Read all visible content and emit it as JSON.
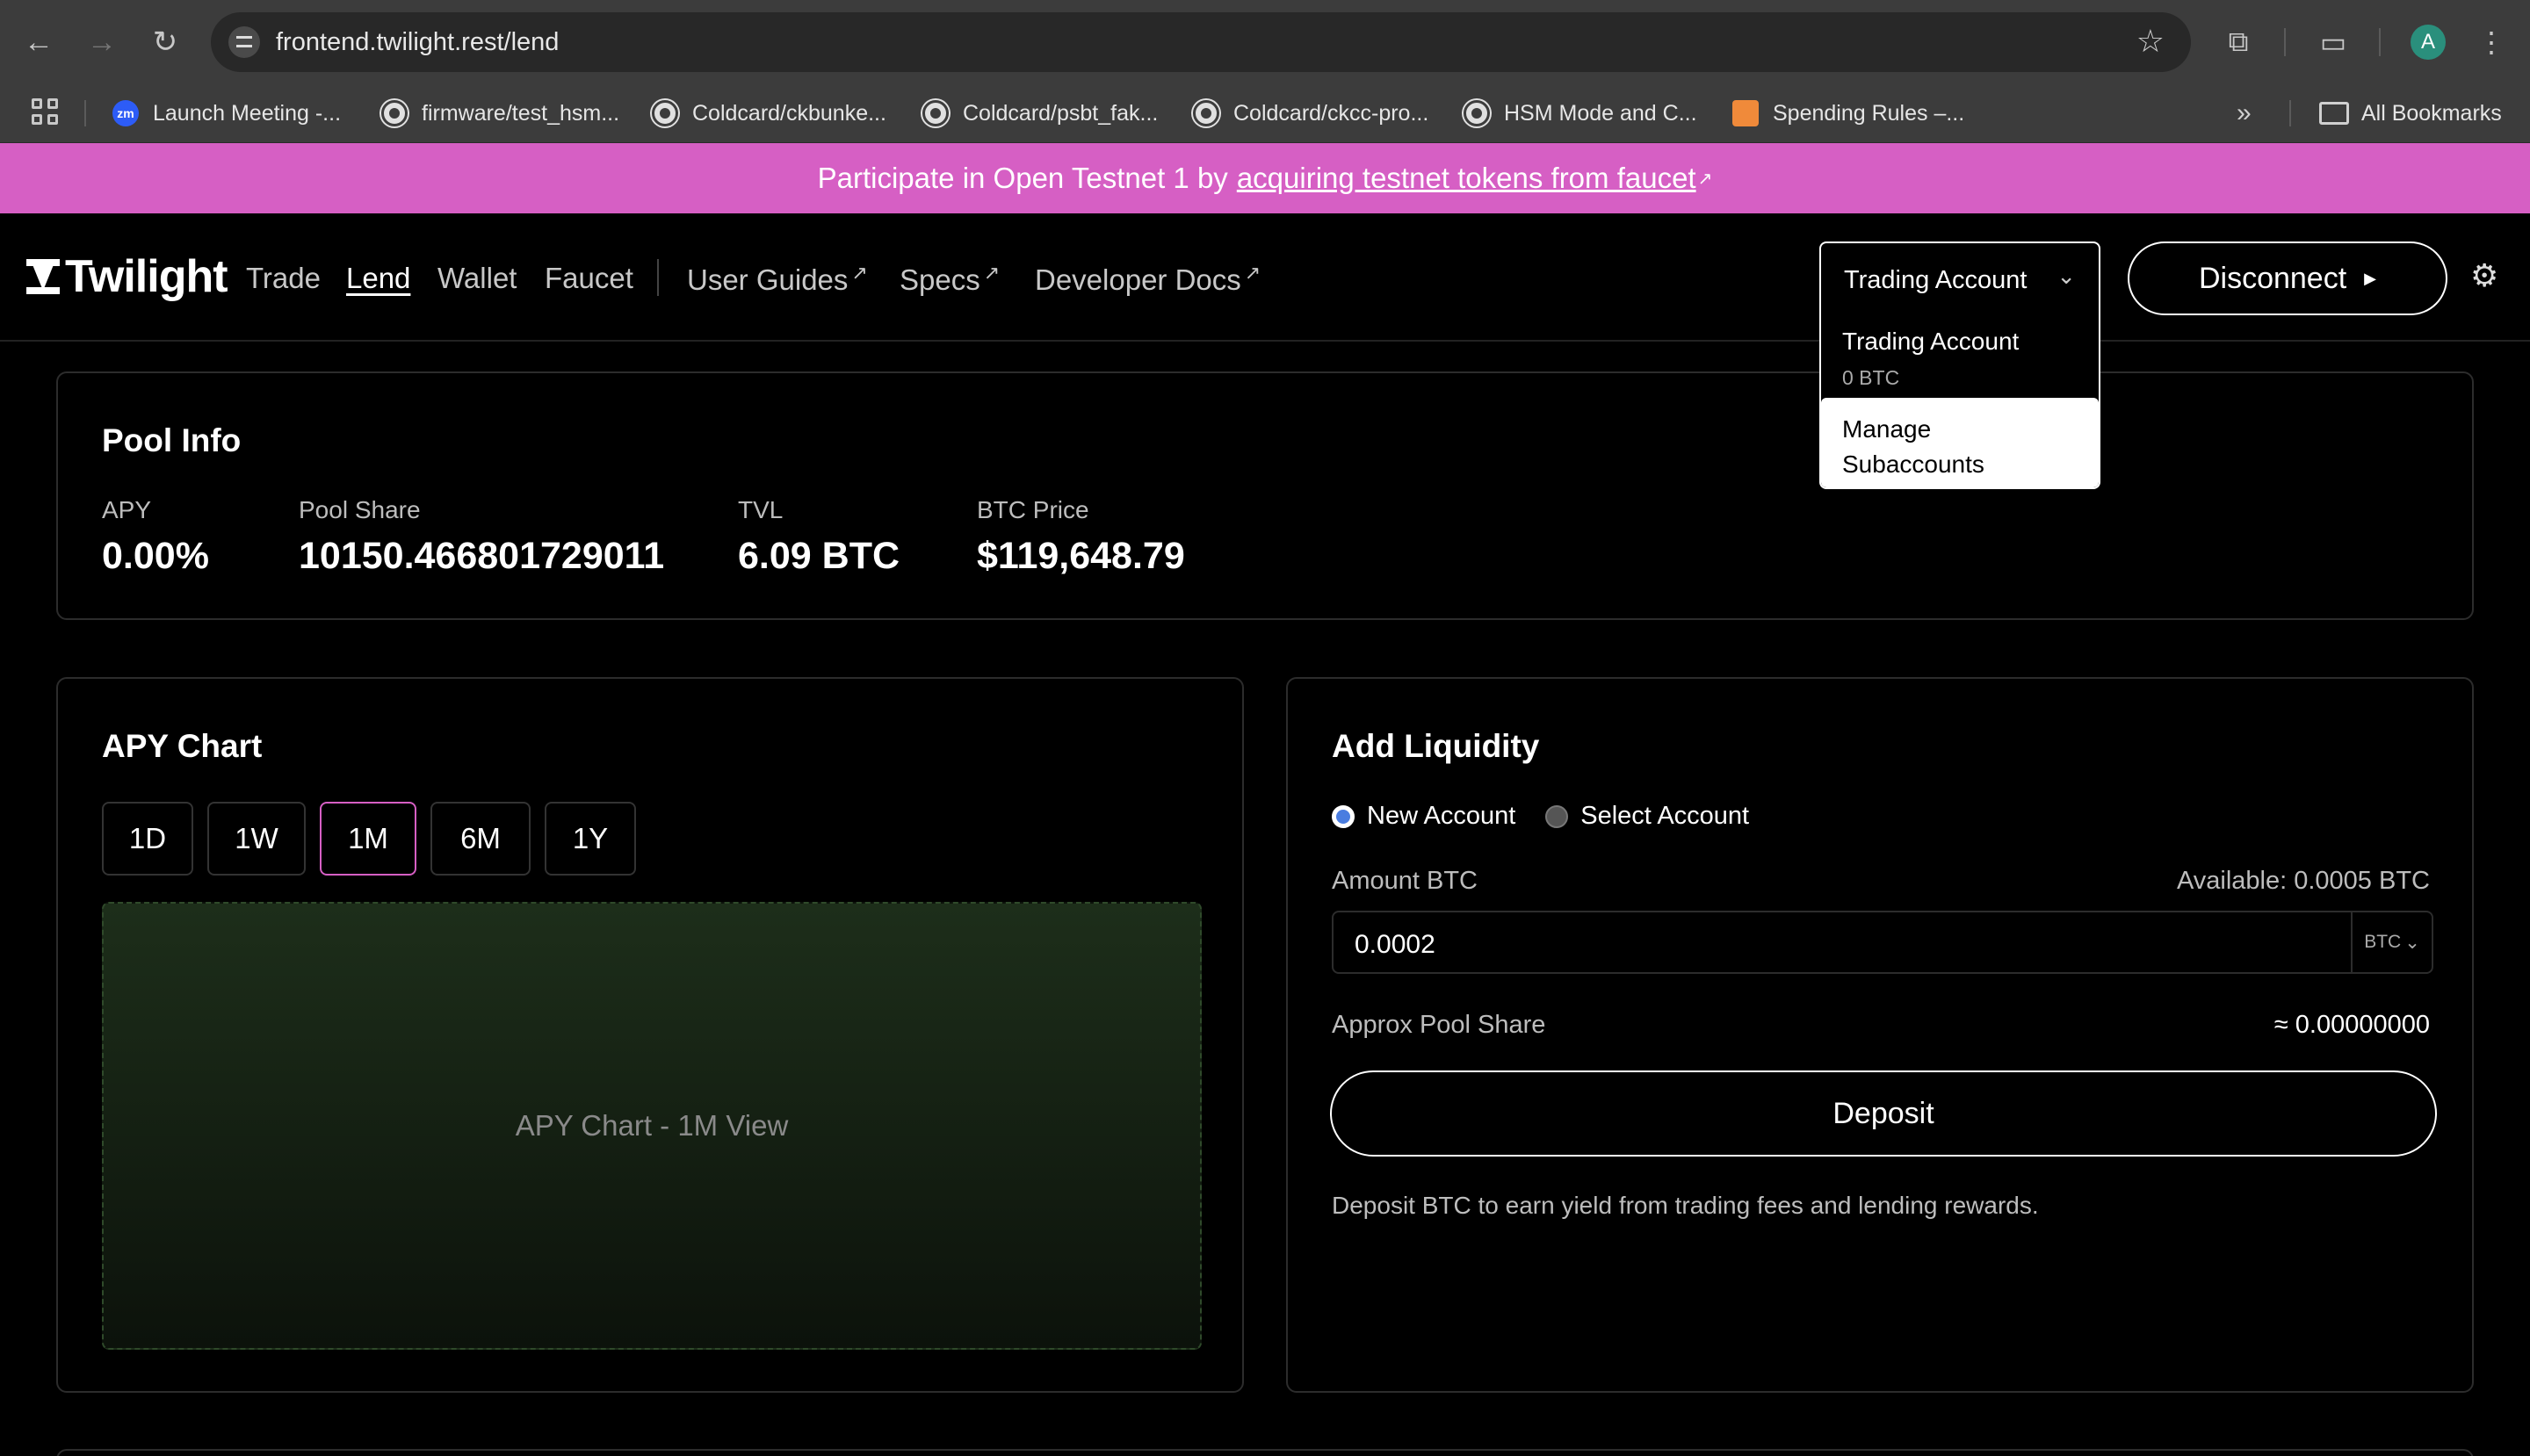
{
  "browser": {
    "url": "frontend.twilight.rest/lend",
    "bookmarks": [
      {
        "label": "Launch Meeting -...",
        "icon": "zoom-icon"
      },
      {
        "label": "firmware/test_hsm...",
        "icon": "github-icon"
      },
      {
        "label": "Coldcard/ckbunke...",
        "icon": "github-icon"
      },
      {
        "label": "Coldcard/psbt_fak...",
        "icon": "github-icon"
      },
      {
        "label": "Coldcard/ckcc-pro...",
        "icon": "github-icon"
      },
      {
        "label": "HSM Mode and C...",
        "icon": "github-icon"
      },
      {
        "label": "Spending Rules –...",
        "icon": "coin-icon"
      }
    ],
    "all_bookmarks": "All Bookmarks",
    "profile_initial": "A"
  },
  "banner": {
    "text": "Participate in Open Testnet 1 by",
    "link": "acquiring testnet tokens from faucet",
    "link_mark": "↗"
  },
  "header": {
    "brand": "Twilight",
    "nav": [
      "Trade",
      "Lend",
      "Wallet",
      "Faucet"
    ],
    "external_nav": [
      "User Guides",
      "Specs",
      "Developer Docs"
    ],
    "external_mark": "↗",
    "account_select": "Trading Account",
    "account_menu": {
      "item_title": "Trading Account",
      "item_balance": "0 BTC",
      "manage": "Manage Subaccounts"
    },
    "disconnect": "Disconnect"
  },
  "pool_info": {
    "title": "Pool Info",
    "stats": [
      {
        "label": "APY",
        "value": "0.00%"
      },
      {
        "label": "Pool Share",
        "value": "10150.466801729011"
      },
      {
        "label": "TVL",
        "value": "6.09 BTC"
      },
      {
        "label": "BTC Price",
        "value": "$119,648.79"
      }
    ]
  },
  "apy_chart": {
    "title": "APY Chart",
    "periods": [
      "1D",
      "1W",
      "1M",
      "6M",
      "1Y"
    ],
    "active_period": "1M",
    "placeholder": "APY Chart - 1M View"
  },
  "add_liquidity": {
    "title": "Add Liquidity",
    "radio_new": "New Account",
    "radio_select": "Select Account",
    "amount_label": "Amount BTC",
    "available": "Available: 0.0005 BTC",
    "amount_value": "0.0002",
    "unit": "BTC",
    "approx_label": "Approx Pool Share",
    "approx_value": "≈ 0.00000000",
    "deposit": "Deposit",
    "help": "Deposit BTC to earn yield from trading fees and lending rewards."
  }
}
